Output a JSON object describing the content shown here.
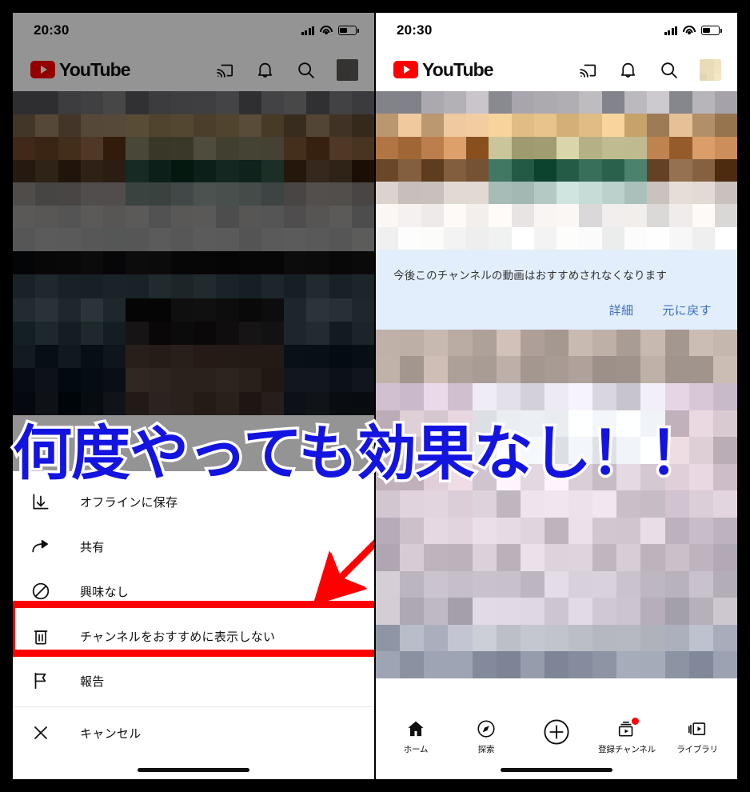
{
  "meta": {
    "caption": "何度やっても効果なし！！",
    "caption_color": "#1414e0",
    "caption_stroke": "#ffffff",
    "annotation_color": "#ff0000"
  },
  "left_phone": {
    "status_bar": {
      "time": "20:30",
      "signal_icon": "cellular-bars-icon",
      "wifi_icon": "wifi-icon",
      "battery_icon": "battery-icon"
    },
    "header": {
      "logo_text": "YouTube",
      "cast_icon": "cast-icon",
      "bell_icon": "notifications-bell-icon",
      "search_icon": "search-icon",
      "avatar": "account-avatar"
    },
    "action_sheet": {
      "items": [
        {
          "label": "オフラインに保存",
          "icon": "download-icon",
          "highlighted": false
        },
        {
          "label": "共有",
          "icon": "share-icon",
          "highlighted": false
        },
        {
          "label": "興味なし",
          "icon": "not-interested-icon",
          "highlighted": false
        },
        {
          "label": "チャンネルをおすすめに表示しない",
          "icon": "trash-icon",
          "highlighted": true
        },
        {
          "label": "報告",
          "icon": "flag-icon",
          "highlighted": false
        },
        {
          "label": "キャンセル",
          "icon": "close-icon",
          "highlighted": false
        }
      ]
    }
  },
  "right_phone": {
    "status_bar": {
      "time": "20:30",
      "signal_icon": "cellular-bars-icon",
      "wifi_icon": "wifi-icon",
      "battery_icon": "battery-icon"
    },
    "header": {
      "logo_text": "YouTube",
      "cast_icon": "cast-icon",
      "bell_icon": "notifications-bell-icon",
      "search_icon": "search-icon",
      "avatar": "account-avatar"
    },
    "banner": {
      "message": "今後このチャンネルの動画はおすすめされなくなります",
      "details_label": "詳細",
      "undo_label": "元に戻す",
      "background": "#e2eefc",
      "link_color": "#3b6fbe"
    },
    "tab_bar": {
      "tabs": [
        {
          "label": "ホーム",
          "icon": "home-icon",
          "badge": false
        },
        {
          "label": "探索",
          "icon": "compass-explore-icon",
          "badge": false
        },
        {
          "label": "",
          "icon": "create-plus-icon",
          "badge": false
        },
        {
          "label": "登録チャンネル",
          "icon": "subscriptions-icon",
          "badge": true
        },
        {
          "label": "ライブラリ",
          "icon": "library-icon",
          "badge": false
        }
      ]
    }
  }
}
